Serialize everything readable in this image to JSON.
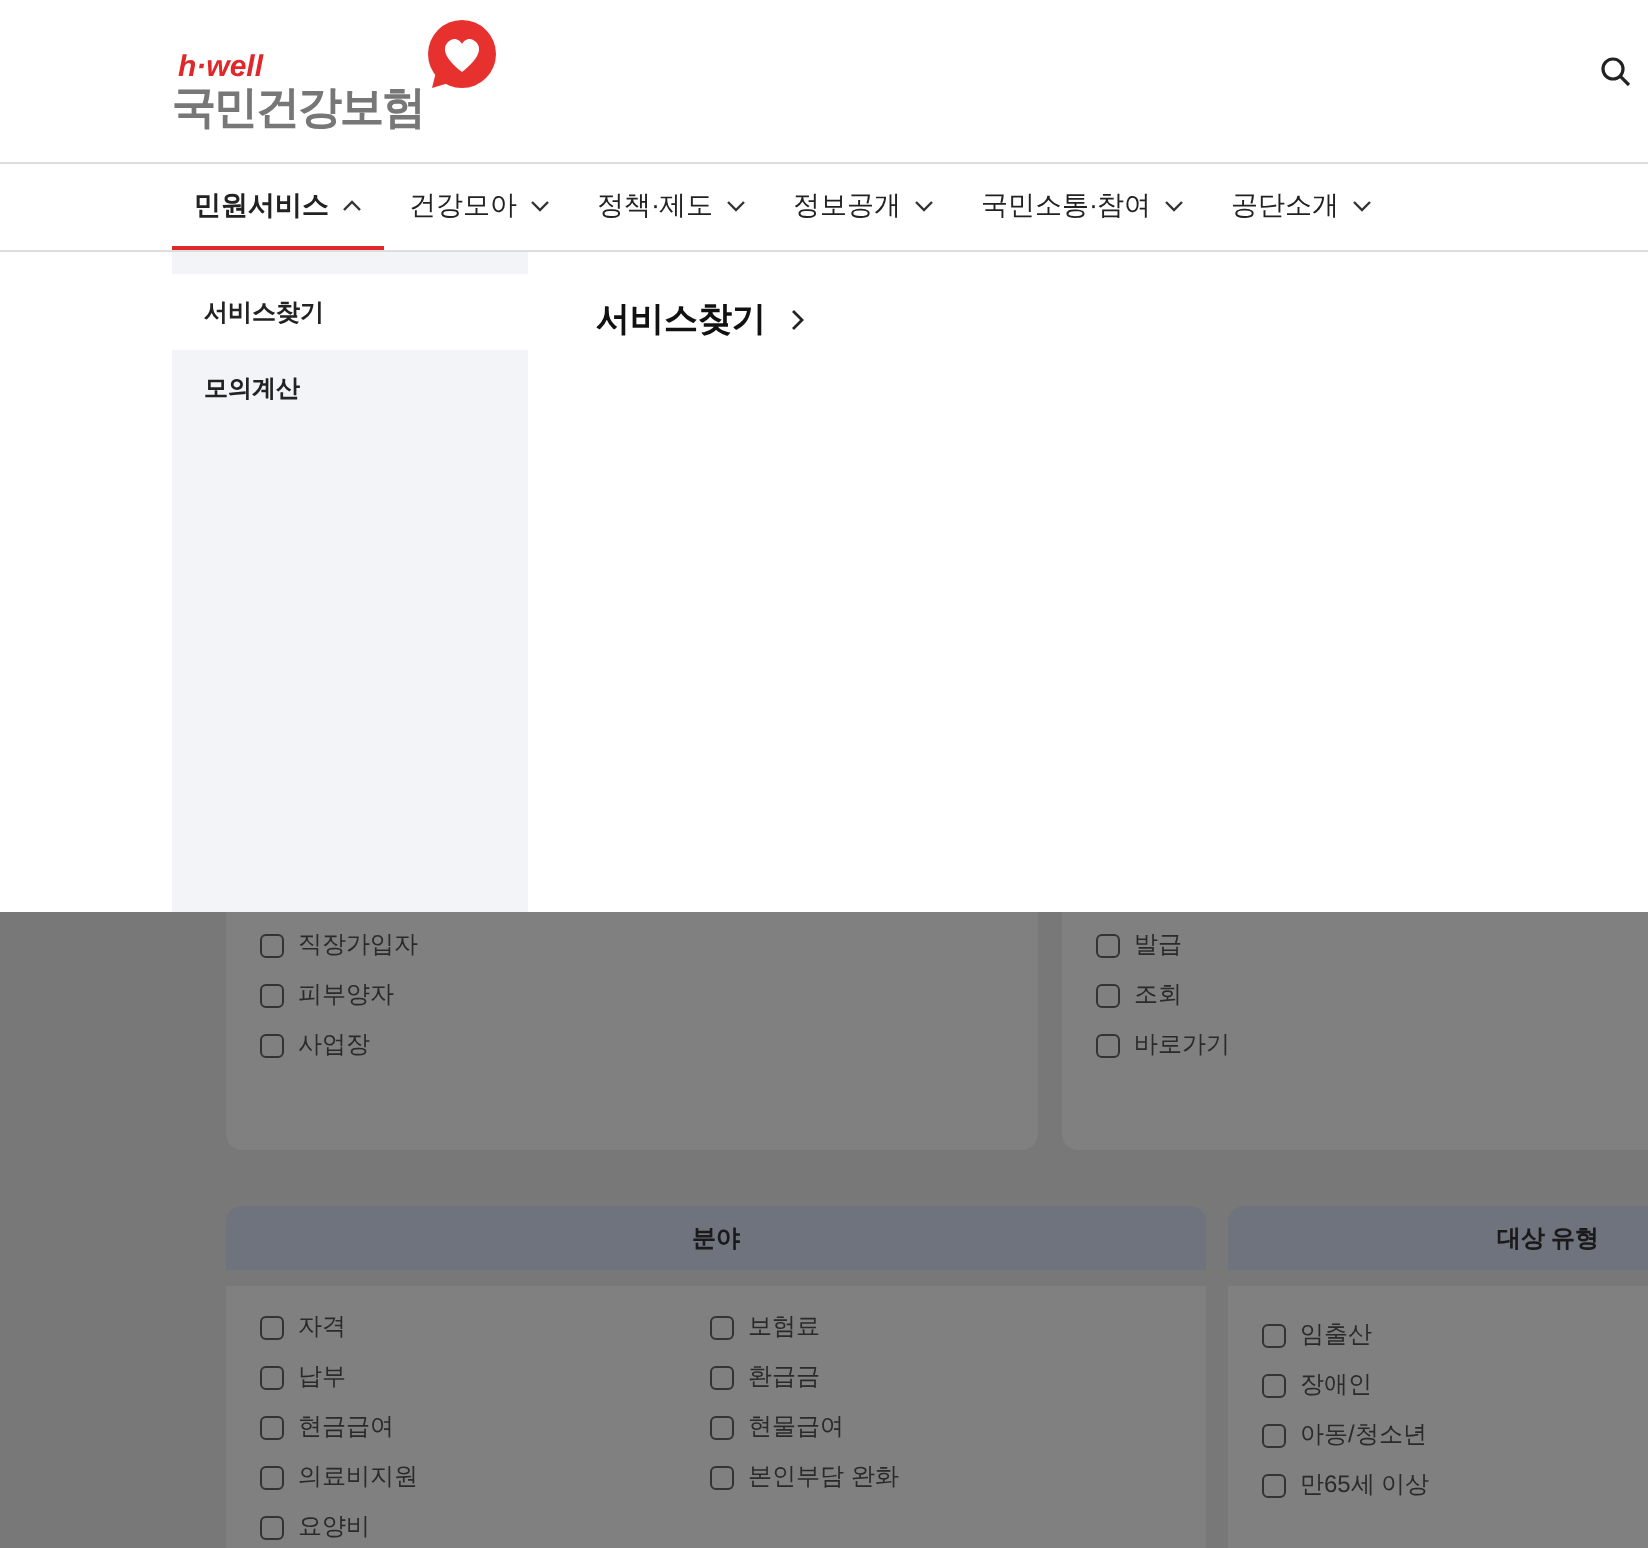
{
  "logo": {
    "tagline": "h·well",
    "name": "국민건강보험"
  },
  "nav": [
    {
      "label": "민원서비스",
      "selected": true
    },
    {
      "label": "건강모아",
      "selected": false
    },
    {
      "label": "정책·제도",
      "selected": false
    },
    {
      "label": "정보공개",
      "selected": false
    },
    {
      "label": "국민소통·참여",
      "selected": false
    },
    {
      "label": "공단소개",
      "selected": false
    }
  ],
  "submenu": [
    {
      "label": "서비스찾기",
      "selected": true
    },
    {
      "label": "모의계산",
      "selected": false
    }
  ],
  "submenu_heading": "서비스찾기",
  "filters_top": [
    {
      "options": [
        {
          "label": "직장가입자",
          "checked": false
        },
        {
          "label": "피부양자",
          "checked": false
        },
        {
          "label": "사업장",
          "checked": false
        }
      ]
    },
    {
      "options": [
        {
          "label": "발급",
          "checked": false
        },
        {
          "label": "조회",
          "checked": false
        },
        {
          "label": "바로가기",
          "checked": false
        }
      ]
    }
  ],
  "field_filter": {
    "title": "분야",
    "options": [
      {
        "label": "자격",
        "checked": false
      },
      {
        "label": "보험료",
        "checked": false
      },
      {
        "label": "납부",
        "checked": false
      },
      {
        "label": "환급금",
        "checked": false
      },
      {
        "label": "현금급여",
        "checked": false
      },
      {
        "label": "현물급여",
        "checked": false
      },
      {
        "label": "의료비지원",
        "checked": false
      },
      {
        "label": "본인부담 완화",
        "checked": false
      },
      {
        "label": "요양비",
        "checked": false
      }
    ]
  },
  "target_filter": {
    "title": "대상 유형",
    "options": [
      {
        "label": "임출산",
        "checked": false
      },
      {
        "label": "장애인",
        "checked": false
      },
      {
        "label": "아동/청소년",
        "checked": false
      },
      {
        "label": "만65세 이상",
        "checked": false
      }
    ]
  }
}
